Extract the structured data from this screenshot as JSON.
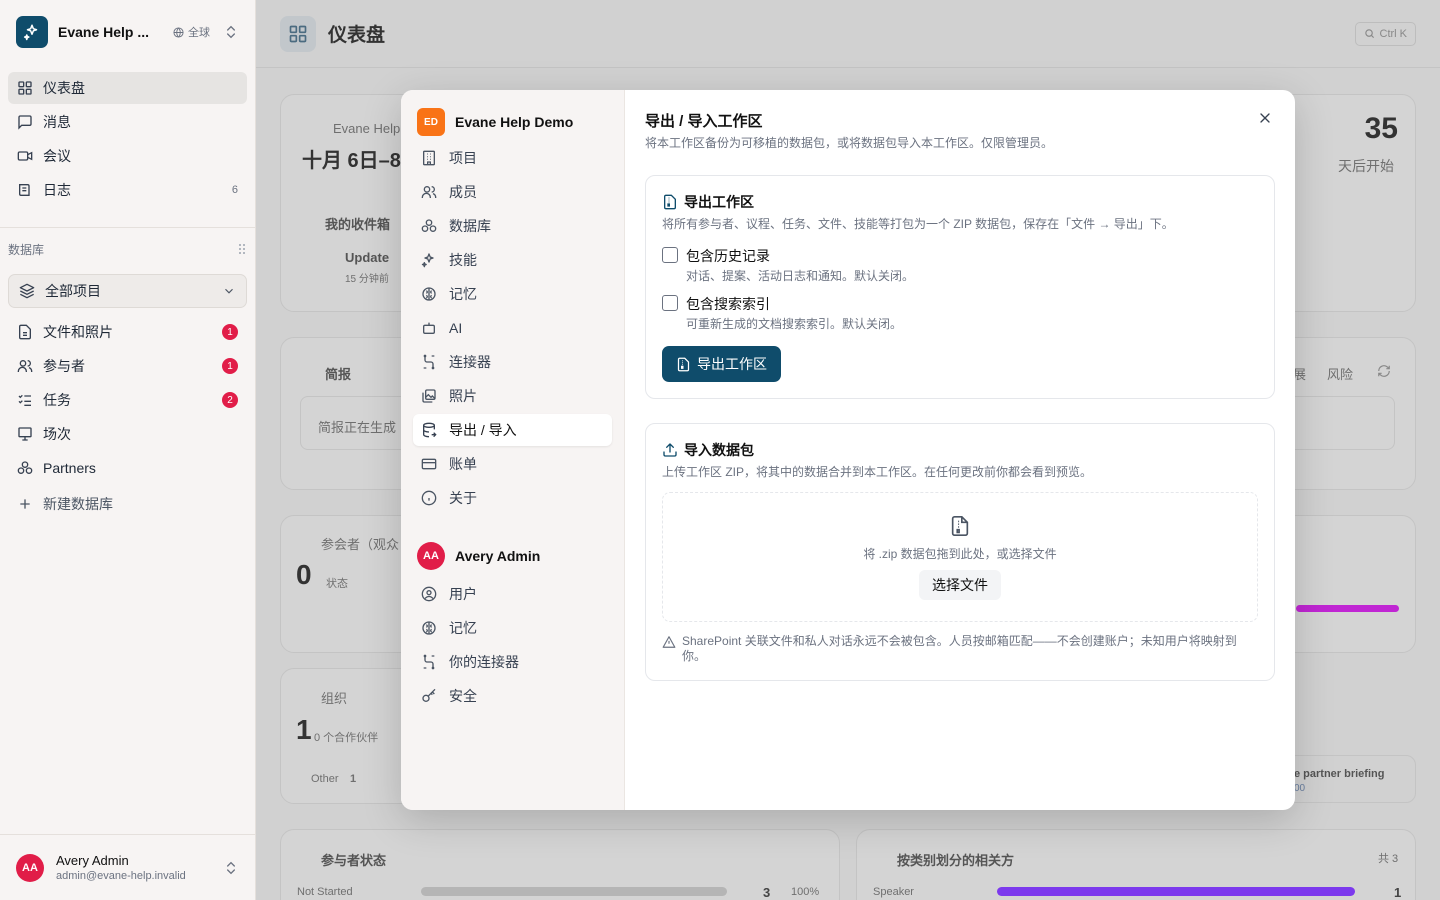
{
  "sidebar": {
    "workspace": {
      "name": "Evane Help ...",
      "scope": "全球"
    },
    "nav": [
      {
        "label": "仪表盘",
        "icon": "dashboard-icon",
        "count": ""
      },
      {
        "label": "消息",
        "icon": "message-icon",
        "count": ""
      },
      {
        "label": "会议",
        "icon": "video-icon",
        "count": ""
      },
      {
        "label": "日志",
        "icon": "log-icon",
        "count": "6"
      }
    ],
    "section_label": "数据库",
    "project_select": "全部项目",
    "db_items": [
      {
        "label": "文件和照片",
        "badge": "1"
      },
      {
        "label": "参与者",
        "badge": "1"
      },
      {
        "label": "任务",
        "badge": "2"
      },
      {
        "label": "场次",
        "badge": ""
      },
      {
        "label": "Partners",
        "badge": ""
      }
    ],
    "new_db": "新建数据库",
    "user": {
      "initials": "AA",
      "name": "Avery Admin",
      "email": "admin@evane-help.invalid"
    }
  },
  "main": {
    "title": "仪表盘",
    "search_shortcut": "Ctrl K",
    "bg": {
      "event_brand": "Evane Help",
      "event_date": "十月 6日–8",
      "countdown": "35",
      "countdown_label": "天后开始",
      "inbox_title": "我的收件箱",
      "inbox_item": "Update",
      "inbox_time": "15 分钟前",
      "briefing_title": "简报",
      "briefing_text": "简报正在生成",
      "briefing_tab1": "展",
      "briefing_tab2": "风险",
      "attendee_title": "参会者（观众",
      "attendee_count": "0",
      "attendee_sub": "状态",
      "org_title": "组织",
      "org_count": "1",
      "org_sub": "0 个合作伙伴",
      "org_legend": "Other",
      "org_legend_val": "1",
      "partner_briefing": "e partner briefing",
      "partner_briefing_sub": "00",
      "status_title": "参与者状态",
      "status_row": "Not Started",
      "status_val": "3",
      "status_pct": "100%",
      "cat_title": "按类别划分的相关方",
      "cat_total": "共 3",
      "cat_row": "Speaker",
      "cat_val": "1"
    }
  },
  "modal": {
    "workspace": {
      "initials": "ED",
      "name": "Evane Help Demo"
    },
    "ws_items": [
      {
        "label": "项目",
        "icon": "building-icon"
      },
      {
        "label": "成员",
        "icon": "users-icon"
      },
      {
        "label": "数据库",
        "icon": "database-icon"
      },
      {
        "label": "技能",
        "icon": "sparkles-icon"
      },
      {
        "label": "记忆",
        "icon": "brain-icon"
      },
      {
        "label": "AI",
        "icon": "bot-icon"
      },
      {
        "label": "连接器",
        "icon": "connector-icon"
      },
      {
        "label": "照片",
        "icon": "photos-icon"
      },
      {
        "label": "导出 / 导入",
        "icon": "export-import-icon"
      },
      {
        "label": "账单",
        "icon": "card-icon"
      },
      {
        "label": "关于",
        "icon": "info-icon"
      }
    ],
    "user": {
      "initials": "AA",
      "name": "Avery Admin"
    },
    "user_items": [
      {
        "label": "用户",
        "icon": "user-circle-icon"
      },
      {
        "label": "记忆",
        "icon": "brain-icon"
      },
      {
        "label": "你的连接器",
        "icon": "connector-icon"
      },
      {
        "label": "安全",
        "icon": "key-icon"
      }
    ],
    "title": "导出 / 导入工作区",
    "subtitle": "将本工作区备份为可移植的数据包，或将数据包导入本工作区。仅限管理员。",
    "export": {
      "title": "导出工作区",
      "desc": "将所有参与者、议程、任务、文件、技能等打包为一个 ZIP 数据包，保存在「文件 → 导出」下。",
      "history_label": "包含历史记录",
      "history_hint": "对话、提案、活动日志和通知。默认关闭。",
      "index_label": "包含搜索索引",
      "index_hint": "可重新生成的文档搜索索引。默认关闭。",
      "button": "导出工作区"
    },
    "import": {
      "title": "导入数据包",
      "desc": "上传工作区 ZIP，将其中的数据合并到本工作区。在任何更改前你都会看到预览。",
      "drop_text": "将 .zip 数据包拖到此处，或选择文件",
      "button": "选择文件",
      "note": "SharePoint 关联文件和私人对话永远不会被包含。人员按邮箱匹配——不会创建账户；未知用户将映射到你。"
    }
  },
  "colors": {
    "brand": "#0f4c6b",
    "badge": "#e11d48",
    "ws_logo": "#f97316"
  }
}
